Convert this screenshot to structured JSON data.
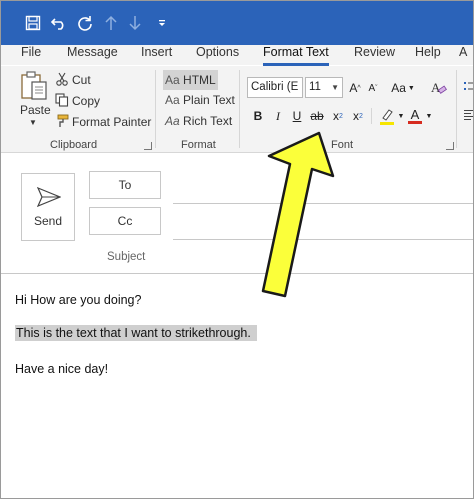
{
  "tabs": [
    {
      "label": "File"
    },
    {
      "label": "Message"
    },
    {
      "label": "Insert"
    },
    {
      "label": "Options"
    },
    {
      "label": "Format Text"
    },
    {
      "label": "Review"
    },
    {
      "label": "Help"
    },
    {
      "label": "A"
    }
  ],
  "clipboard": {
    "paste": "Paste",
    "cut": "Cut",
    "copy": "Copy",
    "format_painter": "Format Painter",
    "group_label": "Clipboard"
  },
  "format": {
    "html": "HTML",
    "plain": "Plain Text",
    "rich": "Rich Text",
    "aa": "Aa",
    "group_label": "Format",
    "selected": "HTML"
  },
  "font": {
    "font_name": "Calibri (E",
    "font_size": "11",
    "bold": "B",
    "italic": "I",
    "underline": "U",
    "strikethrough": "ab",
    "subscript": "x",
    "superscript": "x",
    "group_label": "Font",
    "highlight_color": "#f6e500",
    "font_color": "#d62b1f"
  },
  "compose": {
    "send": "Send",
    "to": "To",
    "cc": "Cc",
    "subject": "Subject"
  },
  "body": {
    "line1": "Hi How are you doing?",
    "line2": "This is the text that I want to strikethrough.",
    "line3": "Have a nice day!"
  },
  "colors": {
    "titlebar": "#2b63b9",
    "arrow_fill": "#fbff3a",
    "arrow_stroke": "#1a1a1a"
  }
}
